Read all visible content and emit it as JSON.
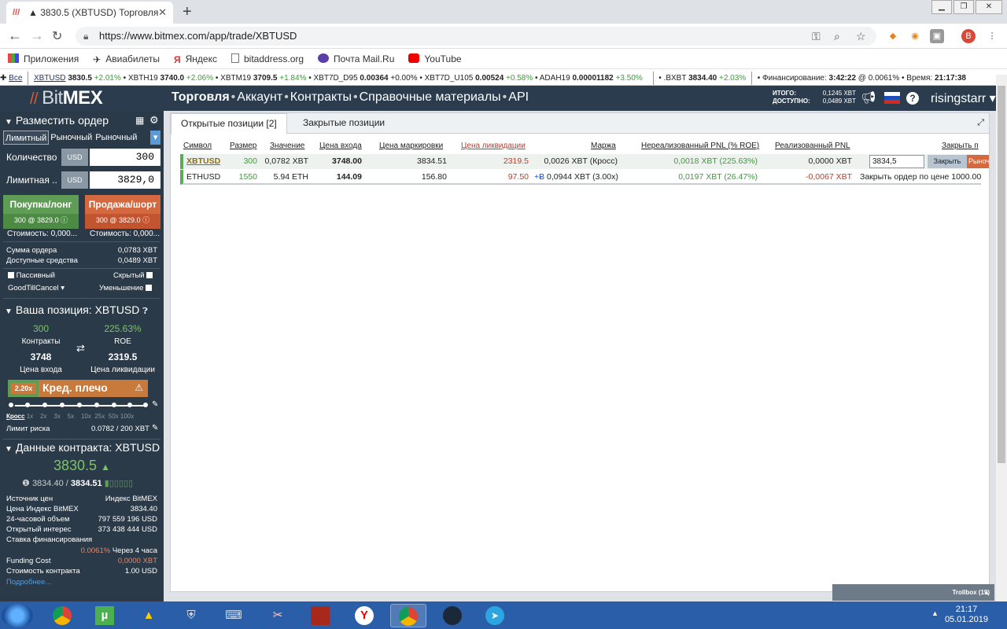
{
  "browser": {
    "tab_title": "▲ 3830.5 (XBTUSD) Торговля - B",
    "tab_close": "✕",
    "new_tab": "+",
    "url": "https://www.bitmex.com/app/trade/XBTUSD",
    "profile_initial": "B",
    "bookmarks": [
      "Приложения",
      "Авиабилеты",
      "Яндекс",
      "bitaddress.org",
      "Почта Mail.Ru",
      "YouTube"
    ]
  },
  "ticker": {
    "all": "Все",
    "items": [
      {
        "sym": "XBTUSD",
        "price": "3830.5",
        "chg": "+2.01%"
      },
      {
        "sym": "XBTH19",
        "price": "3740.0",
        "chg": "+2.06%"
      },
      {
        "sym": "XBTM19",
        "price": "3709.5",
        "chg": "+1.84%"
      },
      {
        "sym": "XBT7D_D95",
        "price": "0.00364",
        "chg": "+0.00%"
      },
      {
        "sym": "XBT7D_U105",
        "price": "0.00524",
        "chg": "+0.58%"
      },
      {
        "sym": "ADAH19",
        "price": "0.00001182",
        "chg": "+3.50%"
      }
    ],
    "bxbt": ".BXBT",
    "bxbt_price": "3834.40",
    "bxbt_chg": "+2.03%",
    "funding_label": "Финансирование:",
    "funding_time": "3:42:22",
    "funding_at": "@ 0.0061%",
    "time_label": "Время:",
    "time": "21:17:38"
  },
  "header": {
    "logo_bit": "Bit",
    "logo_mex": "MEX",
    "nav": [
      "Торговля",
      "Аккаунт",
      "Контракты",
      "Справочные материалы",
      "API"
    ],
    "total_label": "ИТОГО:",
    "total_value": "0,1245 XBT",
    "avail_label": "ДОСТУПНО:",
    "avail_value": "0,0489 XBT",
    "username": "risingstarr"
  },
  "order": {
    "title": "Разместить ордер",
    "tabs": [
      "Лимитный",
      "Рыночный",
      "Рыночный стоп"
    ],
    "qty_label": "Количество",
    "qty_unit": "USD",
    "qty_value": "300",
    "limit_label": "Лимитная ...",
    "limit_unit": "USD",
    "limit_value": "3829,0",
    "buy_label": "Покупка/лонг",
    "buy_sub": "300 @ 3829.0",
    "sell_label": "Продажа/шорт",
    "sell_sub": "300 @ 3829.0",
    "cost_buy": "Стоимость: 0,000...",
    "cost_sell": "Стоимость: 0,000...",
    "order_value_label": "Сумма ордера",
    "order_value": "0,0783 XBT",
    "available_label": "Доступные средства",
    "available": "0,0489 XBT",
    "passive": "Пассивный",
    "hidden": "Скрытый",
    "tif": "GoodTillCancel",
    "reduce": "Уменьшение"
  },
  "position": {
    "title": "Ваша позиция: XBTUSD",
    "contracts_value": "300",
    "contracts_label": "Контракты",
    "roe_value": "225.63%",
    "roe_label": "ROE",
    "entry_value": "3748",
    "entry_label": "Цена входа",
    "liq_value": "2319.5",
    "liq_label": "Цена ликвидации",
    "leverage_x": "2.20x",
    "leverage_label": "Кред. плечо",
    "leverage_progress": 0.22,
    "ticks": [
      "Кросс",
      "1x",
      "2x",
      "3x",
      "5x",
      "10x",
      "25x",
      "50x",
      "100x"
    ],
    "risk_label": "Лимит риска",
    "risk_value": "0.0782 / 200 XBT"
  },
  "contract": {
    "title": "Данные контракта: XBTUSD",
    "last_price": "3830.5",
    "index_price": "3834.40",
    "mark_price": "3834.51",
    "rows": [
      {
        "k": "Источник цен",
        "v": "Индекс BitMEX"
      },
      {
        "k": "Цена Индекс BitMEX",
        "v": "3834.40"
      },
      {
        "k": "24-часовой объем",
        "v": "797 559 196 USD"
      },
      {
        "k": "Открытый интерес",
        "v": "373 438 444 USD"
      },
      {
        "k": "Ставка финансирования",
        "v": ""
      }
    ],
    "funding_rate": "0.0061%",
    "funding_in": "Через 4 часа",
    "funding_cost_label": "Funding Cost",
    "funding_cost": "0,0000 XBT",
    "contract_value_label": "Стоимость контракта",
    "contract_value": "1.00 USD",
    "more": "Подробнее..."
  },
  "positions": {
    "tab_open": "Открытые позиции [2]",
    "tab_closed": "Закрытые позиции",
    "headers": [
      "Символ",
      "Размер",
      "Значение",
      "Цена входа",
      "Цена маркировки",
      "Цена ликвидации",
      "Маржа",
      "Нереализованный PNL (% ROE)",
      "Реализованный PNL",
      "Закрыть п"
    ],
    "rows": [
      {
        "symbol": "XBTUSD",
        "size": "300",
        "value": "0,0782 XBT",
        "entry": "3748.00",
        "mark": "3834.51",
        "liq": "2319.5",
        "margin": "0,0026 XBT (Кросс)",
        "upnl": "0,0018 XBT (225.63%)",
        "rpnl": "0,0000 XBT",
        "close_price": "3834,5",
        "close_btn": "Закрыть",
        "market_btn": "Рыночн"
      },
      {
        "symbol": "ETHUSD",
        "size": "1550",
        "value": "5.94 ETH",
        "entry": "144.09",
        "mark": "156.80",
        "liq": "97.50",
        "margin": "0,0944 XBT (3.00x)",
        "upnl": "0,0197 XBT (26.47%)",
        "rpnl": "-0,0067 XBT",
        "close_text": "Закрыть ордер по цене 1000.00"
      }
    ]
  },
  "trollbox": {
    "label": "Trollbox (19)"
  },
  "taskbar": {
    "time": "21:17",
    "date": "05.01.2019"
  },
  "colors": {
    "header": "#2a3c4d",
    "sidebar": "#2b3a48",
    "buy": "#5f9c55",
    "sell": "#d4683f",
    "green": "#3d9a3d",
    "red": "#c0392b"
  }
}
